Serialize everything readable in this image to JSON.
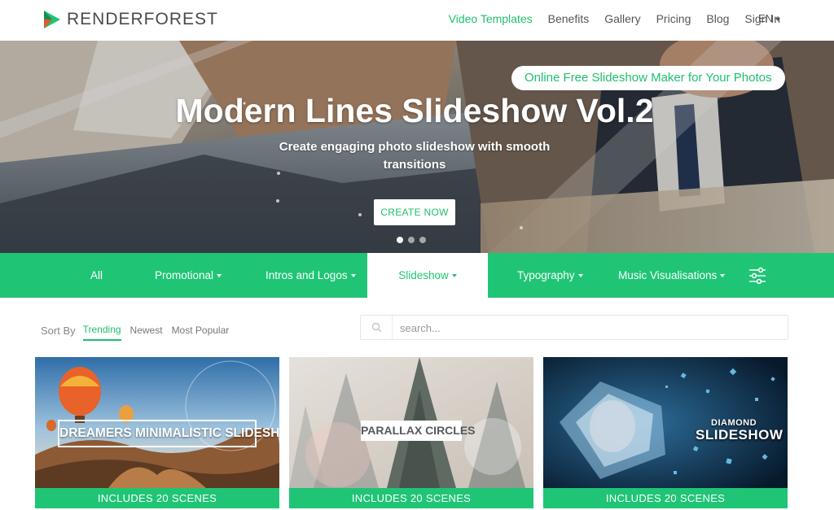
{
  "brand": {
    "logo_text": "RENDERFOREST",
    "accent": "#1fc575"
  },
  "nav": {
    "items": [
      "Video Templates",
      "Benefits",
      "Gallery",
      "Pricing",
      "Blog",
      "Sign In"
    ],
    "active_index": 0,
    "language": "EN"
  },
  "hero": {
    "badge": "Online Free Slideshow Maker for Your Photos",
    "title": "Modern Lines Slideshow Vol.2",
    "subtitle": "Create engaging photo slideshow with smooth transitions",
    "cta": "CREATE NOW",
    "slides": 3,
    "active_slide": 0
  },
  "categories": {
    "items": [
      {
        "label": "All",
        "dropdown": false
      },
      {
        "label": "Promotional",
        "dropdown": true
      },
      {
        "label": "Intros and Logos",
        "dropdown": true
      },
      {
        "label": "Slideshow",
        "dropdown": true
      },
      {
        "label": "Typography",
        "dropdown": true
      },
      {
        "label": "Music Visualisations",
        "dropdown": true
      }
    ],
    "active": "Slideshow",
    "filter_icon": "sliders-icon"
  },
  "sort": {
    "label": "Sort By",
    "options": [
      "Trending",
      "Newest",
      "Most Popular"
    ],
    "active": "Trending"
  },
  "search": {
    "placeholder": "search...",
    "value": ""
  },
  "cards": [
    {
      "title": "DREAMERS MINIMALISTIC SLIDESHOW",
      "footer": "INCLUDES 20 SCENES"
    },
    {
      "title": "PARALLAX CIRCLES",
      "footer": "INCLUDES 20 SCENES"
    },
    {
      "title_line1": "DIAMOND",
      "title_line2": "SLIDESHOW",
      "footer": "INCLUDES 20 SCENES"
    }
  ]
}
